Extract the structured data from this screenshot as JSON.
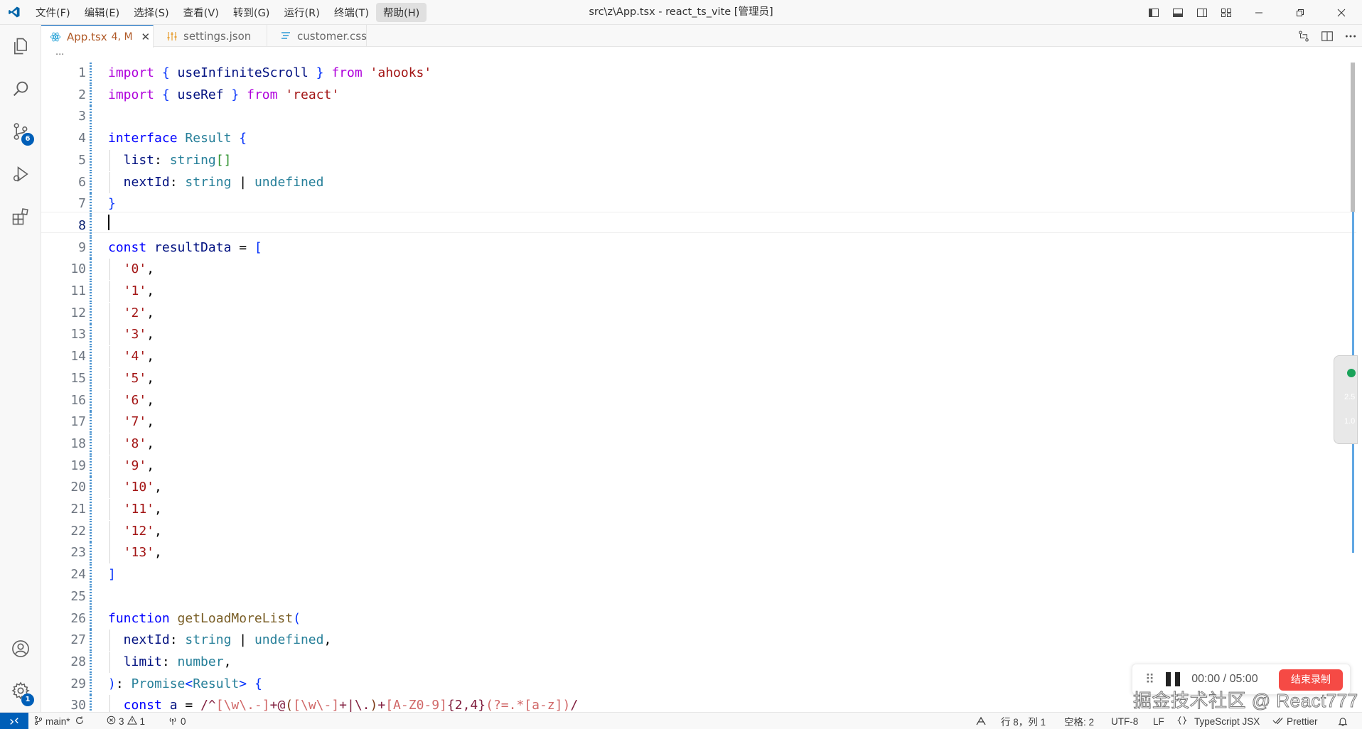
{
  "menu": [
    "文件(F)",
    "编辑(E)",
    "选择(S)",
    "查看(V)",
    "转到(G)",
    "运行(R)",
    "终端(T)",
    "帮助(H)"
  ],
  "window_title": "src\\z\\App.tsx - react_ts_vite [管理员]",
  "tabs": [
    {
      "label": "App.tsx",
      "status": "4, M",
      "icon": "react-icon"
    },
    {
      "label": "settings.json",
      "icon": "settings-file-icon"
    },
    {
      "label": "customer.css",
      "icon": "css-file-icon"
    }
  ],
  "tab_close": "✕",
  "breadcrumb": "...",
  "badges": {
    "source_control": "6",
    "settings": "1"
  },
  "editor": {
    "current_line": 8
  },
  "recorder": {
    "time": "00:00 / 05:00",
    "stop_label": "结束录制",
    "drag": "⠿"
  },
  "watermark": "掘金技术社区 @ React777",
  "side_widget": {
    "up": "2.5",
    "down": "1.0"
  },
  "status": {
    "branch": "main*",
    "errors": "3",
    "warnings": "1",
    "ports": "0",
    "position": "行 8，列 1",
    "spaces": "空格: 2",
    "encoding": "UTF-8",
    "eol": "LF",
    "language": "TypeScript JSX",
    "formatter": "Prettier"
  },
  "code_lines": [
    [
      [
        "import",
        "ctl"
      ],
      [
        " ",
        "punc"
      ],
      [
        "{",
        "br1"
      ],
      [
        " useInfiniteScroll ",
        "var"
      ],
      [
        "}",
        "br1"
      ],
      [
        " ",
        "punc"
      ],
      [
        "from",
        "ctl"
      ],
      [
        " ",
        "punc"
      ],
      [
        "'ahooks'",
        "str"
      ]
    ],
    [
      [
        "import",
        "ctl"
      ],
      [
        " ",
        "punc"
      ],
      [
        "{",
        "br1"
      ],
      [
        " useRef ",
        "var"
      ],
      [
        "}",
        "br1"
      ],
      [
        " ",
        "punc"
      ],
      [
        "from",
        "ctl"
      ],
      [
        " ",
        "punc"
      ],
      [
        "'react'",
        "str"
      ]
    ],
    [],
    [
      [
        "interface",
        "kw"
      ],
      [
        " ",
        "punc"
      ],
      [
        "Result",
        "ty"
      ],
      [
        " ",
        "punc"
      ],
      [
        "{",
        "br1"
      ]
    ],
    [
      [
        "  list",
        "prop"
      ],
      [
        ": ",
        "punc"
      ],
      [
        "string",
        "ty"
      ],
      [
        "[]",
        "br2"
      ]
    ],
    [
      [
        "  nextId",
        "prop"
      ],
      [
        ": ",
        "punc"
      ],
      [
        "string",
        "ty"
      ],
      [
        " | ",
        "punc"
      ],
      [
        "undefined",
        "ty"
      ]
    ],
    [
      [
        "}",
        "br1"
      ]
    ],
    [],
    [
      [
        "const",
        "kw"
      ],
      [
        " ",
        "punc"
      ],
      [
        "resultData",
        "var"
      ],
      [
        " = ",
        "punc"
      ],
      [
        "[",
        "br1"
      ]
    ],
    [
      [
        "  '0'",
        "str"
      ],
      [
        ",",
        "punc"
      ]
    ],
    [
      [
        "  '1'",
        "str"
      ],
      [
        ",",
        "punc"
      ]
    ],
    [
      [
        "  '2'",
        "str"
      ],
      [
        ",",
        "punc"
      ]
    ],
    [
      [
        "  '3'",
        "str"
      ],
      [
        ",",
        "punc"
      ]
    ],
    [
      [
        "  '4'",
        "str"
      ],
      [
        ",",
        "punc"
      ]
    ],
    [
      [
        "  '5'",
        "str"
      ],
      [
        ",",
        "punc"
      ]
    ],
    [
      [
        "  '6'",
        "str"
      ],
      [
        ",",
        "punc"
      ]
    ],
    [
      [
        "  '7'",
        "str"
      ],
      [
        ",",
        "punc"
      ]
    ],
    [
      [
        "  '8'",
        "str"
      ],
      [
        ",",
        "punc"
      ]
    ],
    [
      [
        "  '9'",
        "str"
      ],
      [
        ",",
        "punc"
      ]
    ],
    [
      [
        "  '10'",
        "str"
      ],
      [
        ",",
        "punc"
      ]
    ],
    [
      [
        "  '11'",
        "str"
      ],
      [
        ",",
        "punc"
      ]
    ],
    [
      [
        "  '12'",
        "str"
      ],
      [
        ",",
        "punc"
      ]
    ],
    [
      [
        "  '13'",
        "str"
      ],
      [
        ",",
        "punc"
      ]
    ],
    [
      [
        "]",
        "br1"
      ]
    ],
    [],
    [
      [
        "function",
        "kw"
      ],
      [
        " ",
        "punc"
      ],
      [
        "getLoadMoreList",
        "fn"
      ],
      [
        "(",
        "br1"
      ]
    ],
    [
      [
        "  nextId",
        "prop"
      ],
      [
        ": ",
        "punc"
      ],
      [
        "string",
        "ty"
      ],
      [
        " | ",
        "punc"
      ],
      [
        "undefined",
        "ty"
      ],
      [
        ",",
        "punc"
      ]
    ],
    [
      [
        "  limit",
        "prop"
      ],
      [
        ": ",
        "punc"
      ],
      [
        "number",
        "ty"
      ],
      [
        ",",
        "punc"
      ]
    ],
    [
      [
        ")",
        "br1"
      ],
      [
        ": ",
        "punc"
      ],
      [
        "Promise",
        "ty"
      ],
      [
        "<",
        "br1"
      ],
      [
        "Result",
        "ty"
      ],
      [
        ">",
        "br1"
      ],
      [
        " ",
        "punc"
      ],
      [
        "{",
        "br1"
      ]
    ],
    [
      [
        "  const",
        "kw"
      ],
      [
        " ",
        "punc"
      ],
      [
        "a",
        "var"
      ],
      [
        " = ",
        "punc"
      ],
      [
        "/^",
        "rx"
      ],
      [
        "[\\w\\.-]",
        "rxs"
      ],
      [
        "+@",
        "rx"
      ],
      [
        "(",
        "br3"
      ],
      [
        "[\\w\\-]",
        "rxs"
      ],
      [
        "+|\\.",
        "rx"
      ],
      [
        ")",
        "br3"
      ],
      [
        "+",
        "rx"
      ],
      [
        "[A-Z0-9]",
        "rxs"
      ],
      [
        "{2,4}",
        "rx"
      ],
      [
        "(?=.*",
        "rxs"
      ],
      [
        "[a-z]",
        "rxs"
      ],
      [
        ")",
        "rxs"
      ],
      [
        "/",
        "rx"
      ]
    ]
  ]
}
